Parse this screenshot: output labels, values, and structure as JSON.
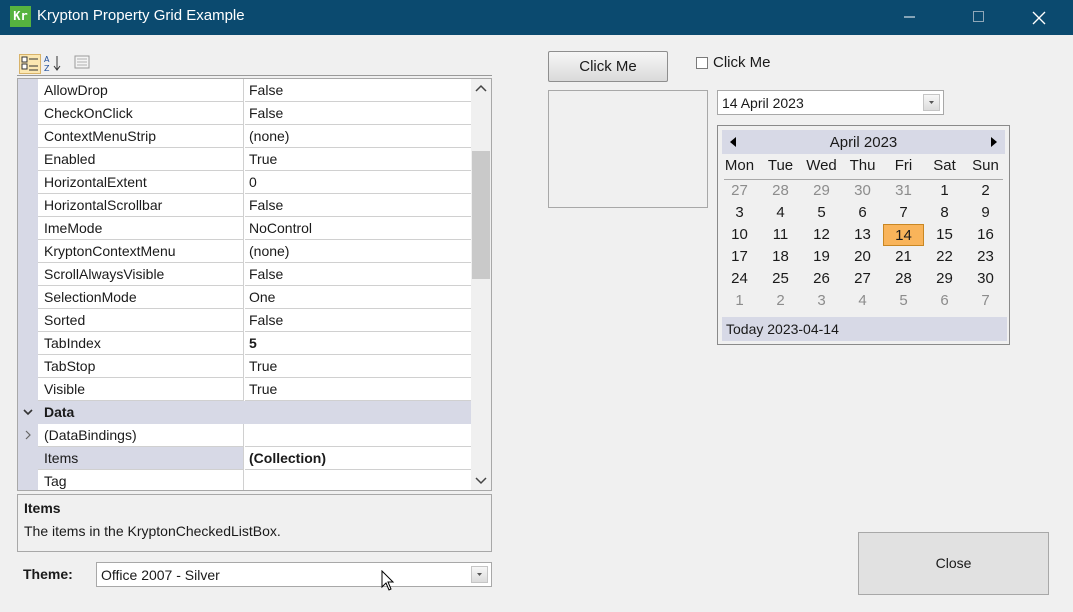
{
  "window": {
    "title": "Krypton Property Grid Example",
    "icon_text": "Kr"
  },
  "property_grid": {
    "rows": [
      {
        "name": "AllowDrop",
        "value": "False"
      },
      {
        "name": "CheckOnClick",
        "value": "False"
      },
      {
        "name": "ContextMenuStrip",
        "value": "(none)"
      },
      {
        "name": "Enabled",
        "value": "True"
      },
      {
        "name": "HorizontalExtent",
        "value": "0"
      },
      {
        "name": "HorizontalScrollbar",
        "value": "False"
      },
      {
        "name": "ImeMode",
        "value": "NoControl"
      },
      {
        "name": "KryptonContextMenu",
        "value": "(none)"
      },
      {
        "name": "ScrollAlwaysVisible",
        "value": "False"
      },
      {
        "name": "SelectionMode",
        "value": "One"
      },
      {
        "name": "Sorted",
        "value": "False"
      },
      {
        "name": "TabIndex",
        "value": "5"
      },
      {
        "name": "TabStop",
        "value": "True"
      },
      {
        "name": "Visible",
        "value": "True"
      },
      {
        "name": "Data",
        "value": ""
      },
      {
        "name": "(DataBindings)",
        "value": ""
      },
      {
        "name": "Items",
        "value": "(Collection)"
      },
      {
        "name": "Tag",
        "value": ""
      }
    ],
    "selected_property": "Items"
  },
  "help": {
    "title": "Items",
    "description": "The items in the KryptonCheckedListBox."
  },
  "theme": {
    "label": "Theme:",
    "value": "Office 2007 - Silver"
  },
  "click_button": {
    "label": "Click Me"
  },
  "checkbox": {
    "label": "Click Me",
    "checked": false
  },
  "date_picker": {
    "value": "14 April 2023"
  },
  "calendar": {
    "month_label": "April 2023",
    "days_of_week": [
      "Mon",
      "Tue",
      "Wed",
      "Thu",
      "Fri",
      "Sat",
      "Sun"
    ],
    "weeks": [
      [
        "27",
        "28",
        "29",
        "30",
        "31",
        "1",
        "2"
      ],
      [
        "3",
        "4",
        "5",
        "6",
        "7",
        "8",
        "9"
      ],
      [
        "10",
        "11",
        "12",
        "13",
        "14",
        "15",
        "16"
      ],
      [
        "17",
        "18",
        "19",
        "20",
        "21",
        "22",
        "23"
      ],
      [
        "24",
        "25",
        "26",
        "27",
        "28",
        "29",
        "30"
      ],
      [
        "1",
        "2",
        "3",
        "4",
        "5",
        "6",
        "7"
      ]
    ],
    "selected_day": "14",
    "today_text": "Today 2023-04-14"
  },
  "close_button": {
    "label": "Close"
  }
}
